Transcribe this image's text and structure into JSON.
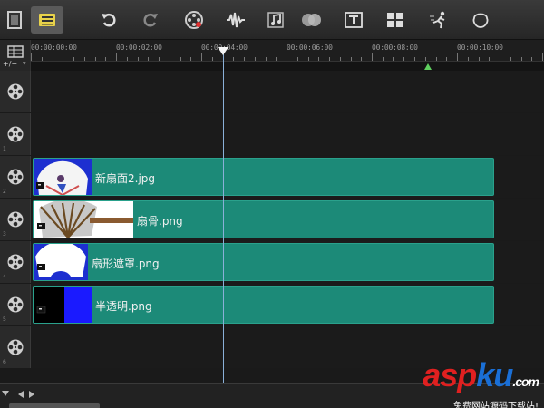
{
  "toolbar": {
    "buttons": [
      {
        "name": "storyboard-view-icon"
      },
      {
        "name": "timeline-view-icon",
        "active": true
      },
      {
        "name": "undo-icon"
      },
      {
        "name": "redo-icon"
      },
      {
        "name": "record-capture-icon"
      },
      {
        "name": "sound-mixer-icon"
      },
      {
        "name": "auto-music-icon"
      },
      {
        "name": "motion-tracking-icon"
      },
      {
        "name": "subtitle-editor-icon"
      },
      {
        "name": "multi-camera-icon"
      },
      {
        "name": "time-remapping-icon"
      },
      {
        "name": "mask-creator-icon"
      }
    ]
  },
  "ruler": {
    "labels": [
      "00:00:00:00",
      "00:00:02:00",
      "00:00:04:00",
      "00:00:06:00",
      "00:00:08:00",
      "00:00:10:00"
    ],
    "add_track_label": "+/−"
  },
  "tracks": [
    {
      "number": "",
      "clip": null
    },
    {
      "number": "1",
      "clip": null
    },
    {
      "number": "2",
      "clip": {
        "label": "新扇面2.jpg",
        "thumb": "fan-painting"
      }
    },
    {
      "number": "3",
      "clip": {
        "label": "扇骨.png",
        "thumb": "fan-ribs"
      }
    },
    {
      "number": "4",
      "clip": {
        "label": "扇形遮罩.png",
        "thumb": "fan-mask"
      }
    },
    {
      "number": "5",
      "clip": {
        "label": "半透明.png",
        "thumb": "translucent"
      }
    },
    {
      "number": "6",
      "clip": null
    }
  ],
  "watermark": {
    "part1": "asp",
    "part2": "ku",
    "suffix": ".com",
    "tagline": "免费网站源码下载站!"
  },
  "colors": {
    "clip": "#1c8a78",
    "playhead": "#8ab0d8",
    "marker": "#5fd05f"
  }
}
